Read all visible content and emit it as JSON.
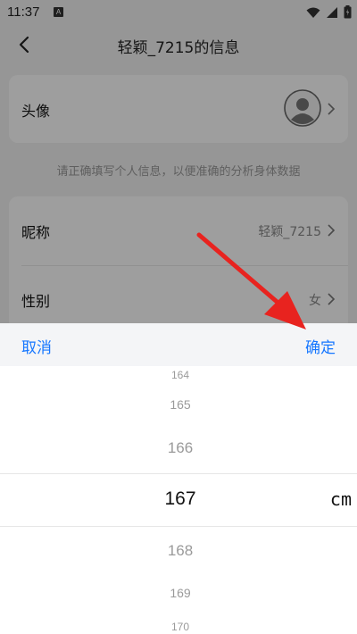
{
  "status_bar": {
    "time": "11:37",
    "notification_letter": "A"
  },
  "header": {
    "title": "轻颖_7215的信息"
  },
  "profile": {
    "avatar_label": "头像",
    "hint": "请正确填写个人信息，以便准确的分析身体数据",
    "nickname_label": "昵称",
    "nickname_value": "轻颖_7215",
    "gender_label": "性别",
    "gender_value": "女"
  },
  "picker": {
    "cancel_label": "取消",
    "confirm_label": "确定",
    "items": [
      "164",
      "165",
      "166",
      "167",
      "168",
      "169",
      "170"
    ],
    "selected": "167",
    "unit": "cm"
  },
  "colors": {
    "accent": "#1677ff",
    "annotation_arrow": "#e8231f"
  }
}
